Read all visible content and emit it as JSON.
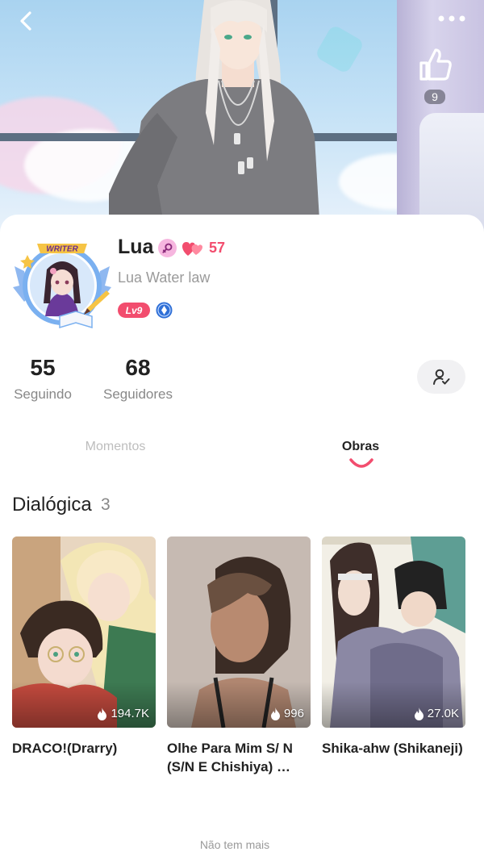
{
  "header": {
    "back_icon": "chevron-left-icon",
    "more_icon": "more-horizontal-icon",
    "like_icon": "thumbs-up-icon",
    "like_count": "9"
  },
  "profile": {
    "name": "Lua",
    "gender_icon": "female-icon",
    "heart_icon": "hearts-icon",
    "heart_count": "57",
    "handle": "Lua Water law",
    "level": "Lv9",
    "verify_icon": "diamond-badge-icon",
    "avatar_frame_text": "WRITER",
    "accent_color": "#f24d6e"
  },
  "stats": {
    "following_count": "55",
    "following_label": "Seguindo",
    "followers_count": "68",
    "followers_label": "Seguidores",
    "follow_icon": "user-check-icon"
  },
  "tabs": [
    {
      "label": "Momentos",
      "active": false
    },
    {
      "label": "Obras",
      "active": true
    }
  ],
  "section": {
    "title": "Dialógica",
    "count": "3"
  },
  "books": [
    {
      "title": "DRACO!(Drarry)",
      "views": "194.7K"
    },
    {
      "title": "Olhe Para Mim S/ N (S/N E Chishiya) …",
      "views": "996"
    },
    {
      "title": "Shika-ahw (Shikaneji)",
      "views": "27.0K"
    }
  ],
  "footer": {
    "note": "Não tem mais"
  }
}
